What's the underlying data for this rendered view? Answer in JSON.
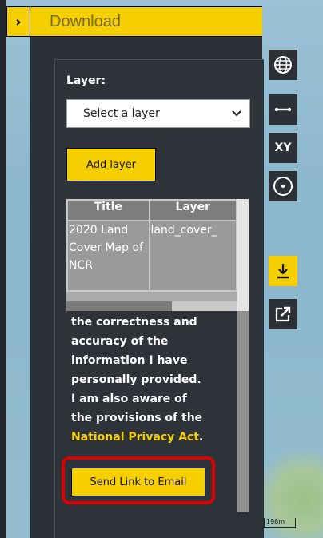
{
  "panel": {
    "title": "Download",
    "collapse_icon": "chevron-right-icon"
  },
  "form": {
    "layer_label": "Layer:",
    "layer_select": {
      "value": "Select a layer",
      "icon": "chevron-down-icon"
    },
    "add_layer_label": "Add layer"
  },
  "layers_table": {
    "headers": [
      "Title",
      "Layer"
    ],
    "rows": [
      {
        "title": "2020 Land Cover Map of NCR",
        "layer": "land_cover_"
      }
    ]
  },
  "consent": {
    "lines": [
      "the correctness and",
      "accuracy of the",
      "information I have",
      "personally provided.",
      "I am also aware of",
      "the provisions of the"
    ],
    "link_text": "National Privacy Act",
    "link_suffix": ".",
    "link_color": "#f5cf00"
  },
  "send_link_label": "Send Link to Email",
  "toolbar": {
    "items": [
      {
        "name": "globe-icon"
      },
      {
        "name": "measure-icon"
      },
      {
        "name": "xy-coordinates",
        "label": "XY"
      },
      {
        "name": "locate-icon"
      },
      {
        "name": "download-icon"
      },
      {
        "name": "external-link-icon"
      }
    ]
  },
  "map": {
    "scale_label": "198m"
  },
  "colors": {
    "accent": "#f5cf00",
    "panel_bg": "#2b3137",
    "highlight": "#e00000"
  }
}
